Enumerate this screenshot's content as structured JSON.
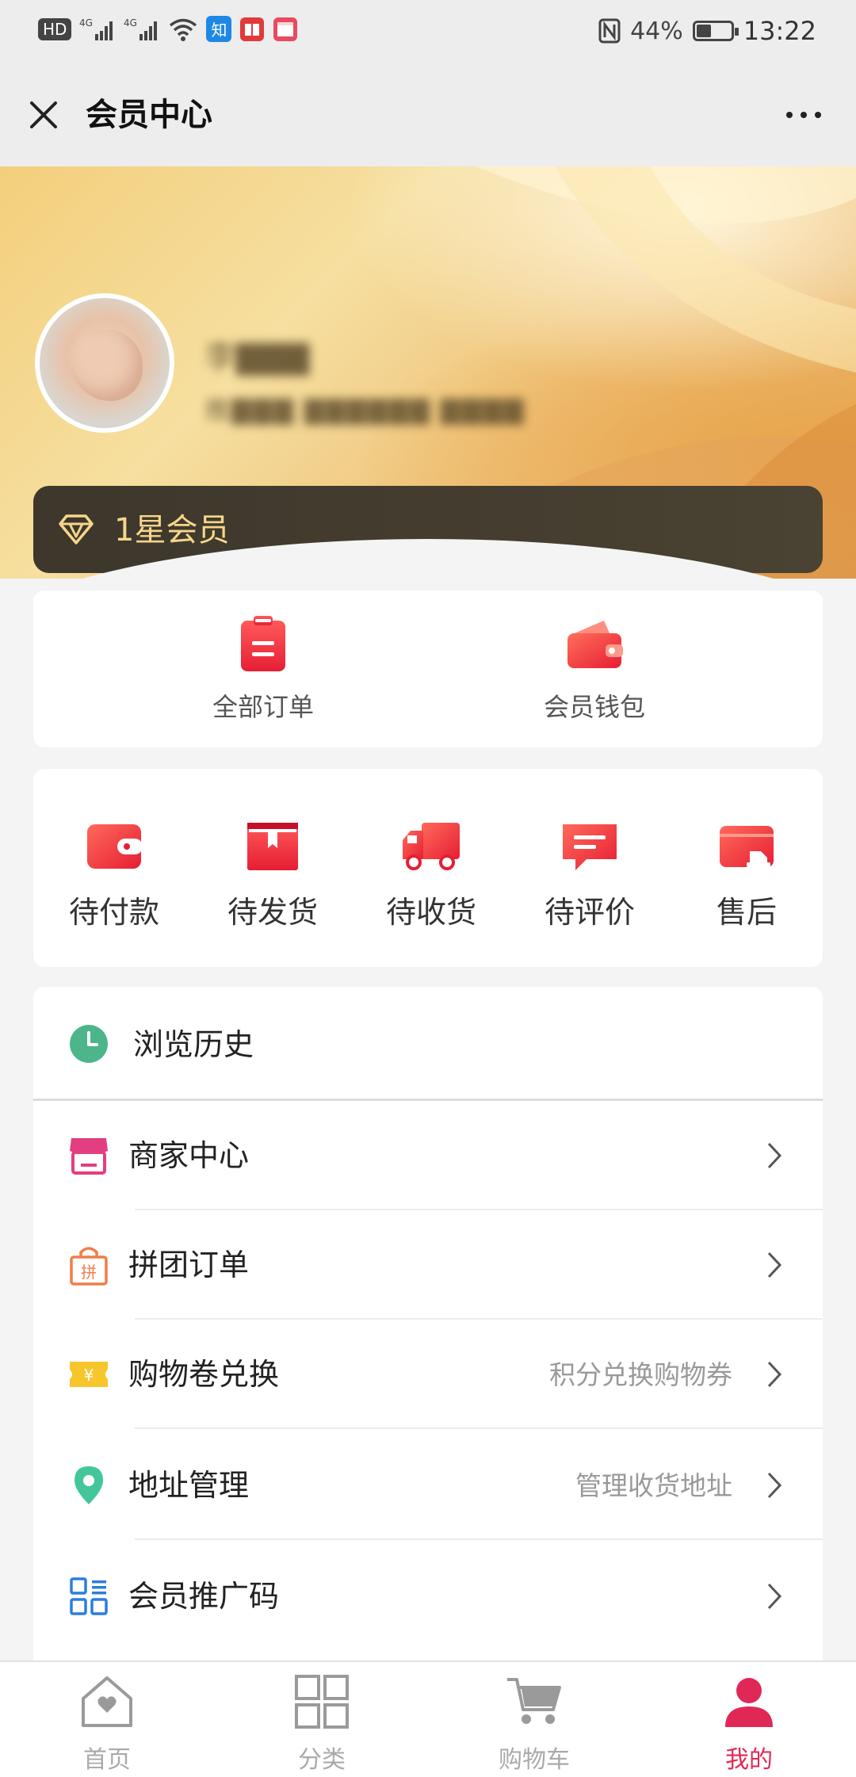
{
  "status_bar": {
    "left_icons": [
      "hd-icon",
      "signal-4g-icon",
      "signal-4g-icon",
      "wifi-icon",
      "zhihu-app-icon",
      "reader-app-icon",
      "calendar-app-icon"
    ],
    "hd_label": "HD",
    "zhihu_label": "知",
    "battery_percent_text": "44%",
    "battery_level": 0.44,
    "time": "13:22"
  },
  "nav": {
    "title": "会员中心"
  },
  "profile": {
    "name": "李",
    "sub": "推",
    "membership_level": "1星会员"
  },
  "quick_links": [
    {
      "label": "全部订单",
      "icon": "clipboard-icon"
    },
    {
      "label": "会员钱包",
      "icon": "wallet-icon"
    }
  ],
  "order_status": [
    {
      "label": "待付款",
      "icon": "pay-wallet-icon"
    },
    {
      "label": "待发货",
      "icon": "package-icon"
    },
    {
      "label": "待收货",
      "icon": "truck-icon"
    },
    {
      "label": "待评价",
      "icon": "comment-icon"
    },
    {
      "label": "售后",
      "icon": "after-sales-icon"
    }
  ],
  "menu": {
    "history": {
      "label": "浏览历史",
      "icon": "clock-icon"
    },
    "items": [
      {
        "label": "商家中心",
        "sub": "",
        "icon": "store-icon"
      },
      {
        "label": "拼团订单",
        "sub": "",
        "icon": "group-buy-bag-icon"
      },
      {
        "label": "购物卷兑换",
        "sub": "积分兑换购物券",
        "icon": "coupon-icon"
      },
      {
        "label": "地址管理",
        "sub": "管理收货地址",
        "icon": "location-pin-icon"
      },
      {
        "label": "会员推广码",
        "sub": "",
        "icon": "qr-code-icon"
      }
    ]
  },
  "coupon_icon_glyph": "¥",
  "group_buy_icon_glyph": "拼",
  "tabs": [
    {
      "label": "首页",
      "icon": "home-icon",
      "active": false
    },
    {
      "label": "分类",
      "icon": "category-grid-icon",
      "active": false
    },
    {
      "label": "购物车",
      "icon": "cart-icon",
      "active": false
    },
    {
      "label": "我的",
      "icon": "profile-icon",
      "active": true
    }
  ],
  "colors": {
    "accent_red": "#f5323e",
    "active_tab": "#e02856",
    "member_gold": "#f7d68a",
    "clock_green": "#4cb58a",
    "store_pink": "#e33e80",
    "group_orange": "#f07d4b",
    "coupon_yellow": "#f7c62c",
    "pin_green": "#43c79a",
    "qr_blue": "#2b7de0"
  }
}
